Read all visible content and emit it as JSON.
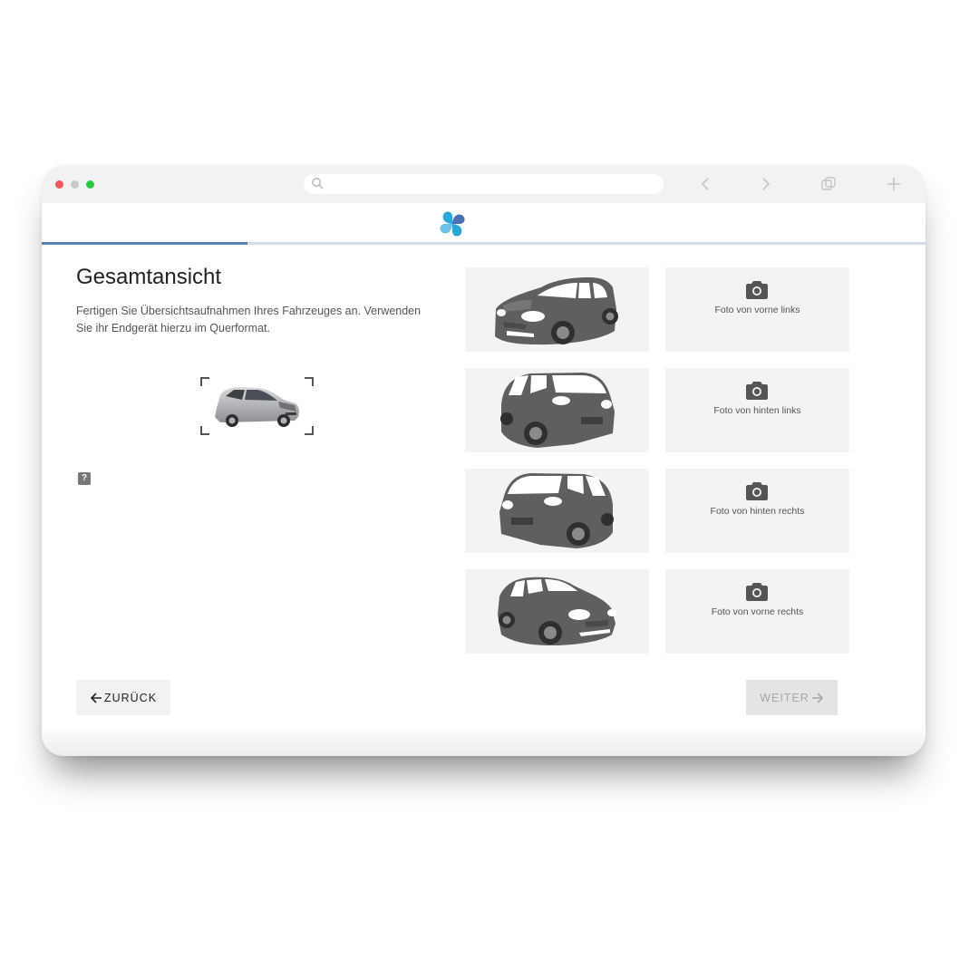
{
  "browser": {
    "search_icon": "search-icon",
    "nav_icons": [
      "back-arrow-icon",
      "forward-arrow-icon",
      "tabs-icon",
      "plus-icon"
    ]
  },
  "colors": {
    "progress": "#5b82b0",
    "track": "#d3dde6",
    "car": "#5f5f5f",
    "tile": "#f3f3f3"
  },
  "progress": {
    "fraction": 0.233
  },
  "page": {
    "title": "Gesamtansicht",
    "description": "Fertigen Sie Übersichtsaufnahmen Ihres Fahrzeuges an. Verwenden Sie ihr Endgerät hierzu im Querformat.",
    "help_label": "?"
  },
  "photos": [
    {
      "label": "Foto von vorne links",
      "view": "front-left"
    },
    {
      "label": "Foto von hinten links",
      "view": "rear-left"
    },
    {
      "label": "Foto von hinten rechts",
      "view": "rear-right"
    },
    {
      "label": "Foto von vorne rechts",
      "view": "front-right"
    }
  ],
  "buttons": {
    "back": "ZURÜCK",
    "next": "WEITER"
  }
}
